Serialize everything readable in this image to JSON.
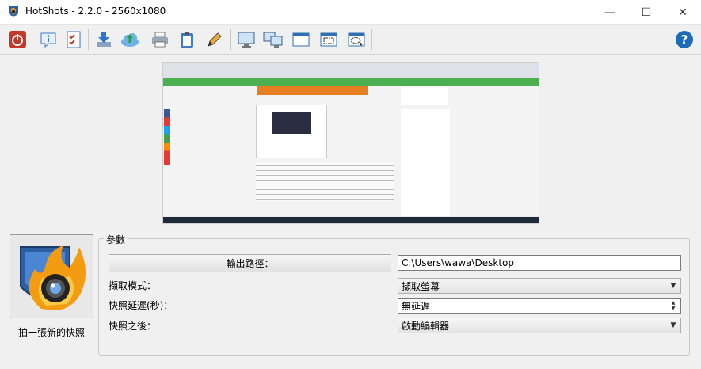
{
  "window": {
    "title": "HotShots - 2.2.0 - 2560x1080",
    "controls": {
      "minimize": "—",
      "maximize": "☐",
      "close": "✕"
    }
  },
  "toolbar": {
    "buttons": [
      {
        "name": "quit-icon"
      },
      {
        "name": "about-icon"
      },
      {
        "name": "checklist-icon"
      },
      {
        "name": "download-icon"
      },
      {
        "name": "upload-cloud-icon"
      },
      {
        "name": "print-icon"
      },
      {
        "name": "clipboard-icon"
      },
      {
        "name": "edit-pencil-icon"
      },
      {
        "name": "fullscreen-capture-icon"
      },
      {
        "name": "multiscreen-capture-icon"
      },
      {
        "name": "window-capture-icon"
      },
      {
        "name": "region-capture-icon"
      },
      {
        "name": "freehand-capture-icon"
      }
    ],
    "help": {
      "name": "help-icon",
      "glyph": "?"
    }
  },
  "snapshot": {
    "label": "拍一張新的快照"
  },
  "params": {
    "legend": "參數",
    "output_path_button": "輸出路徑：",
    "output_path_value": "C:\\Users\\wawa\\Desktop",
    "capture_mode_label": "擷取模式：",
    "capture_mode_value": "擷取螢幕",
    "delay_label": "快照延遲(秒)：",
    "delay_value": "無延遲",
    "after_label": "快照之後：",
    "after_value": "啟動編輯器"
  },
  "colors": {
    "accent_green": "#4caf50",
    "help_blue": "#1e6bb8",
    "quit_red": "#c0392b"
  }
}
